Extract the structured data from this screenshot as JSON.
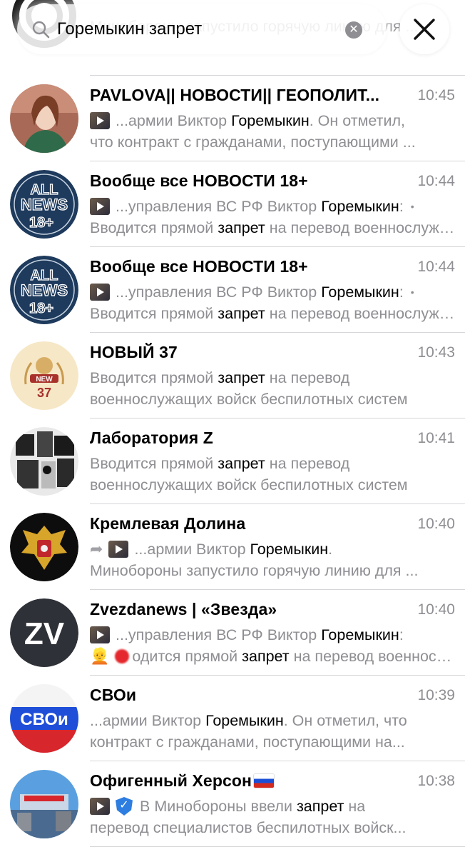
{
  "search": {
    "query": "Горемыкин запрет",
    "clear_icon": "clear-icon",
    "close_icon": "close-icon"
  },
  "chats": [
    {
      "title": "",
      "time": "",
      "line1": [],
      "line2": [
        {
          "t": "Минобороны запустило горячую линию для ...",
          "hl": false
        }
      ]
    },
    {
      "title": "PAVLOVA|| НОВОСТИ|| ГЕОПОЛИТ...",
      "time": "10:45",
      "line1": [
        {
          "t": "...армии Виктор ",
          "hl": false
        },
        {
          "t": "Горемыкин",
          "hl": true
        },
        {
          "t": ". Он отметил,",
          "hl": false
        }
      ],
      "line2": [
        {
          "t": "что контракт с гражданами, поступающими ...",
          "hl": false
        }
      ]
    },
    {
      "title": "Вообще все НОВОСТИ 18+",
      "time": "10:44",
      "line1": [
        {
          "t": "...управления ВС РФ Виктор ",
          "hl": false
        },
        {
          "t": "Горемыкин",
          "hl": true
        },
        {
          "t": ":",
          "hl": false
        }
      ],
      "line2": [
        {
          "t": "Вводится прямой ",
          "hl": false
        },
        {
          "t": "запрет",
          "hl": true
        },
        {
          "t": " на перевод военнослужащих",
          "hl": false
        }
      ]
    },
    {
      "title": "Вообще все НОВОСТИ 18+",
      "time": "10:44",
      "line1": [
        {
          "t": "...управления ВС РФ Виктор ",
          "hl": false
        },
        {
          "t": "Горемыкин",
          "hl": true
        },
        {
          "t": ":",
          "hl": false
        }
      ],
      "line2": [
        {
          "t": "Вводится прямой ",
          "hl": false
        },
        {
          "t": "запрет",
          "hl": true
        },
        {
          "t": " на перевод военнослужащих",
          "hl": false
        }
      ]
    },
    {
      "title": "НОВЫЙ 37",
      "time": "10:43",
      "line1": [
        {
          "t": "Вводится прямой ",
          "hl": false
        },
        {
          "t": "запрет",
          "hl": true
        },
        {
          "t": " на перевод",
          "hl": false
        }
      ],
      "line2": [
        {
          "t": "военнослужащих войск беспилотных систем",
          "hl": false
        }
      ]
    },
    {
      "title": "Лаборатория Z",
      "time": "10:41",
      "line1": [
        {
          "t": "Вводится прямой ",
          "hl": false
        },
        {
          "t": "запрет",
          "hl": true
        },
        {
          "t": " на перевод",
          "hl": false
        }
      ],
      "line2": [
        {
          "t": "военнослужащих войск беспилотных систем",
          "hl": false
        }
      ]
    },
    {
      "title": "Кремлевая Долина",
      "time": "10:40",
      "line1": [
        {
          "t": "...армии Виктор ",
          "hl": false
        },
        {
          "t": "Горемыкин",
          "hl": true
        },
        {
          "t": ".",
          "hl": false
        }
      ],
      "line2": [
        {
          "t": "Минобороны запустило горячую линию для ...",
          "hl": false
        }
      ]
    },
    {
      "title": "Zvezdanews | «Звезда»",
      "time": "10:40",
      "line1": [
        {
          "t": "...управления ВС РФ Виктор ",
          "hl": false
        },
        {
          "t": "Горемыкин",
          "hl": true
        },
        {
          "t": ":",
          "hl": false
        }
      ],
      "line2": [
        {
          "t": "одится прямой ",
          "hl": false
        },
        {
          "t": "запрет",
          "hl": true
        },
        {
          "t": " на перевод военнослужащих",
          "hl": false
        }
      ]
    },
    {
      "title": "СВОи",
      "time": "10:39",
      "line1": [
        {
          "t": "...армии Виктор ",
          "hl": false
        },
        {
          "t": "Горемыкин",
          "hl": true
        },
        {
          "t": ". Он отметил, что",
          "hl": false
        }
      ],
      "line2": [
        {
          "t": "контракт с гражданами, поступающими на...",
          "hl": false
        }
      ]
    },
    {
      "title": "Офигенный Херсон",
      "time": "10:38",
      "line1": [
        {
          "t": "В Минобороны ввели ",
          "hl": false
        },
        {
          "t": "запрет",
          "hl": true
        },
        {
          "t": " на",
          "hl": false
        }
      ],
      "line2": [
        {
          "t": "перевод специалистов беспилотных войск...",
          "hl": false
        }
      ]
    }
  ],
  "avatar_texts": {
    "allnews": [
      "ALL",
      "NEWS",
      "18+"
    ],
    "new37": [
      "NEW",
      "37"
    ],
    "zv": "ZV",
    "svoi": "СВОи"
  }
}
